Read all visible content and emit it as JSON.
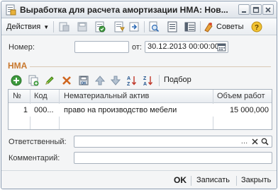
{
  "window": {
    "title": "Выработка для расчета амортизации НМА: Нов..."
  },
  "toolbar": {
    "actions_label": "Действия",
    "advice_label": "Советы"
  },
  "form": {
    "number_label": "Номер:",
    "number_value": "",
    "date_label": "от:",
    "date_value": "30.12.2013 00:00:00"
  },
  "section": {
    "title": "НМА"
  },
  "table_toolbar": {
    "select_label": "Подбор"
  },
  "table": {
    "columns": [
      "№",
      "Код",
      "Нематериальный актив",
      "Объем работ"
    ],
    "rows": [
      {
        "num": "1",
        "code": "000...",
        "asset": "право на производство мебели",
        "volume": "15 000,000"
      }
    ]
  },
  "responsible": {
    "label": "Ответственный:",
    "value": ""
  },
  "comment": {
    "label": "Комментарий:",
    "value": ""
  },
  "footer": {
    "ok_label": "OK",
    "save_label": "Записать",
    "close_label": "Закрыть"
  },
  "colors": {
    "section_title": "#c9782e",
    "window_border": "#8a9bb0"
  }
}
